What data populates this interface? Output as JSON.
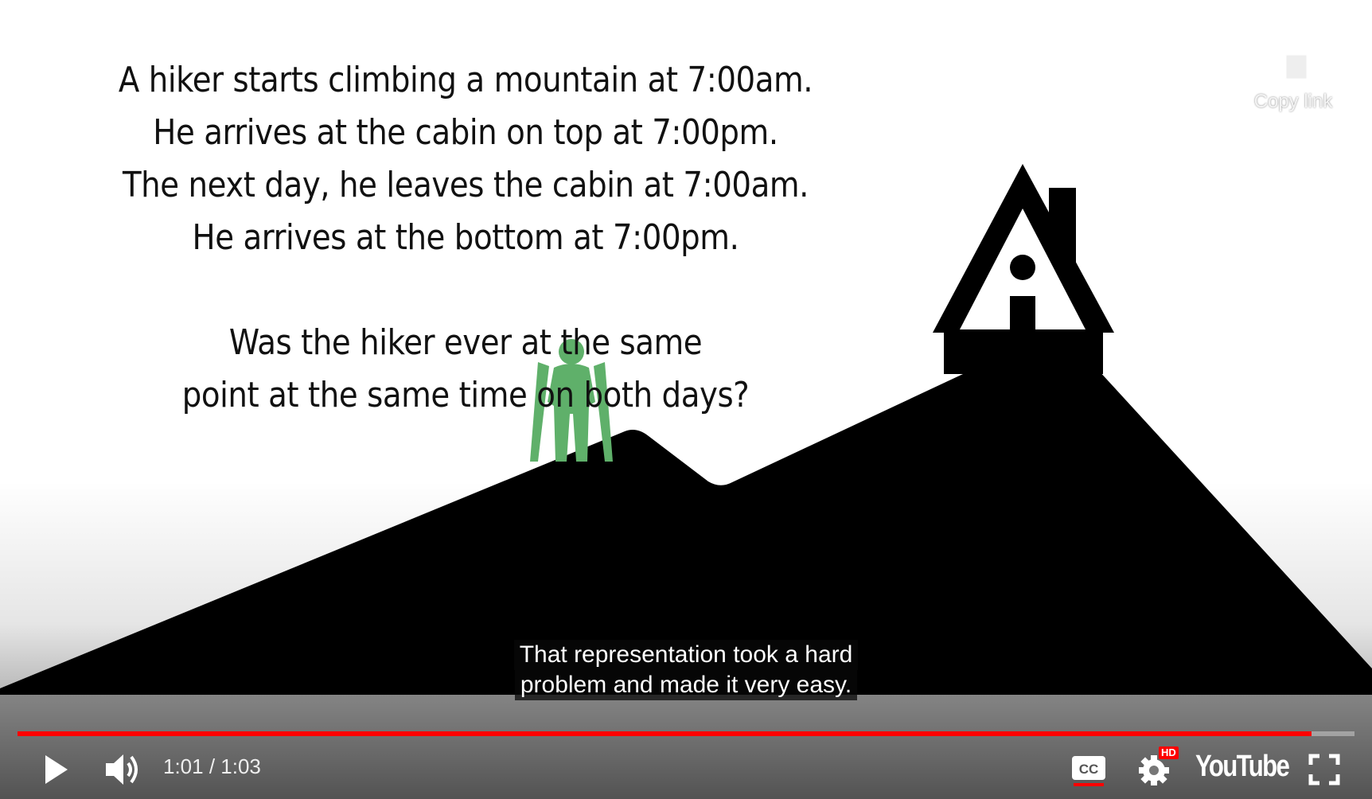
{
  "video": {
    "riddle_lines": [
      "A hiker starts climbing a mountain at 7:00am.",
      "He arrives at the cabin on top at 7:00pm.",
      "The next day, he leaves the cabin at 7:00am.",
      "He arrives at the bottom at 7:00pm."
    ],
    "question_lines": [
      "Was the hiker ever at the same",
      "point at the same time on both days?"
    ],
    "hiker_color": "#5fb06a"
  },
  "overlay": {
    "copy_link_label": "Copy link",
    "copy_icon": "copy-icon"
  },
  "captions": {
    "lines": [
      "That representation took a hard",
      "problem and made it very easy."
    ]
  },
  "player": {
    "progress_fraction": 0.968,
    "progress_color": "#ff0000",
    "current_time": "1:01",
    "separator": " / ",
    "duration": "1:03",
    "hd_badge": "HD",
    "logo_text": "YouTube",
    "icons": [
      "play-icon",
      "volume-icon",
      "cc-icon",
      "gear-icon",
      "fullscreen-icon"
    ]
  }
}
